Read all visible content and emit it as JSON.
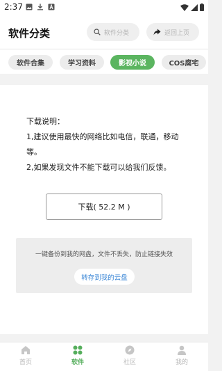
{
  "status_bar": {
    "time": "2:37",
    "left_icons": [
      "image-icon",
      "download-icon",
      "text-a-icon"
    ],
    "right_icons": [
      "wifi-icon",
      "signal-icon",
      "battery-icon"
    ]
  },
  "header": {
    "title": "软件分类",
    "search_label": "软件分类",
    "back_label": "返回上页"
  },
  "tabs": [
    {
      "label": "软件合集",
      "active": false
    },
    {
      "label": "学习资料",
      "active": false
    },
    {
      "label": "影视小说",
      "active": true
    },
    {
      "label": "COS腐宅",
      "active": false
    }
  ],
  "description": {
    "heading": "下载说明：",
    "line1": "1,建议使用最快的网络比如电信，联通，移动等。",
    "line2": "2,如果发现文件不能下载可以给我们反馈。"
  },
  "download_button": "下载( 52.2 M )",
  "backup": {
    "text": "一键备份到我的网盘，文件不丢失，防止链接失效",
    "button": "转存到我的云盘"
  },
  "bottom_nav": [
    {
      "label": "首页",
      "icon": "home-icon",
      "active": false
    },
    {
      "label": "软件",
      "icon": "grid-icon",
      "active": true
    },
    {
      "label": "社区",
      "icon": "compass-icon",
      "active": false
    },
    {
      "label": "我的",
      "icon": "person-icon",
      "active": false
    }
  ],
  "colors": {
    "accent": "#5bb560",
    "link": "#3a86d6",
    "background": "#f2f2f2"
  }
}
